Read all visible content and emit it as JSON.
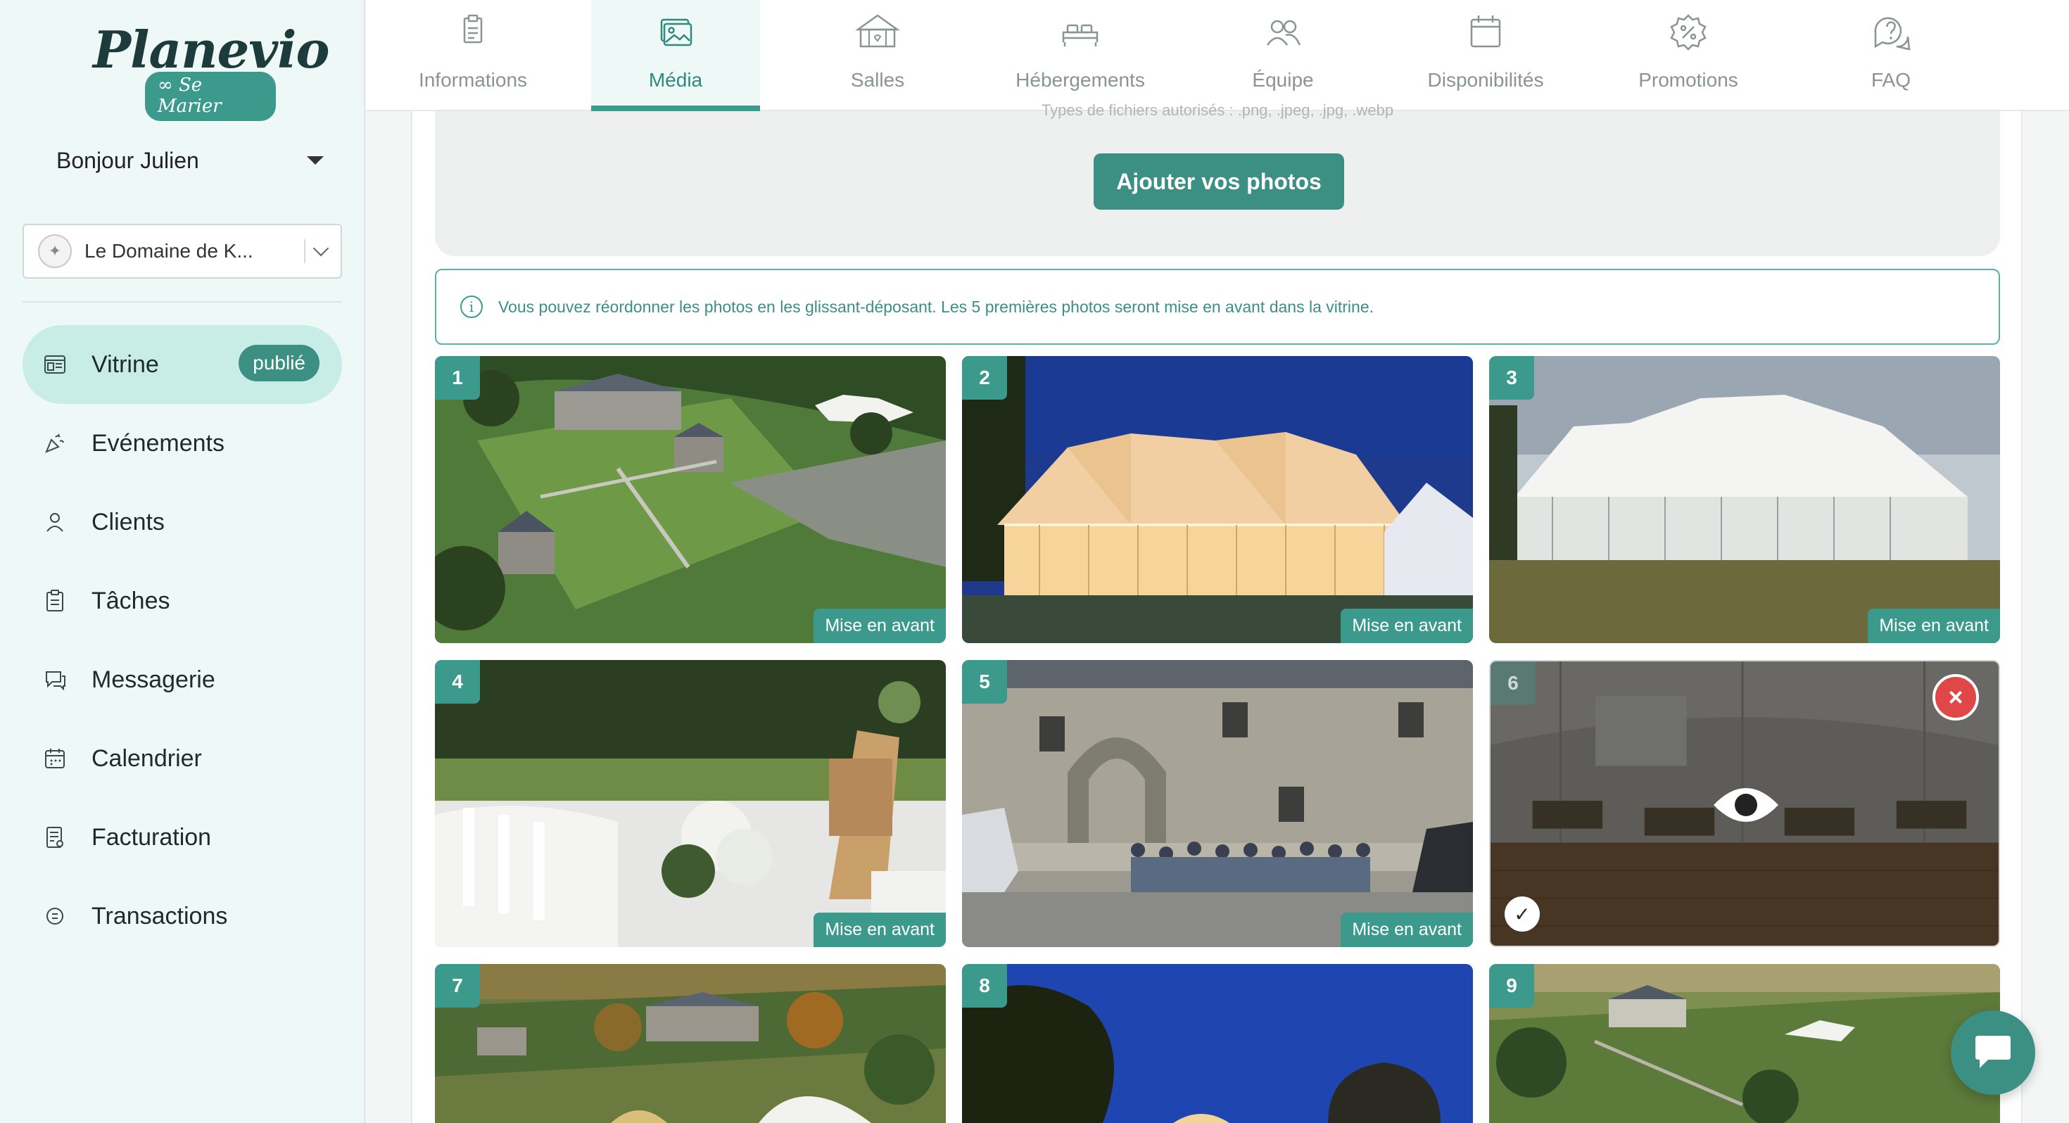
{
  "brand": {
    "name": "Planevio",
    "tagline": "Se Marier"
  },
  "sidebar": {
    "greeting": "Bonjour Julien",
    "venue": "Le Domaine de K...",
    "items": [
      {
        "label": "Vitrine",
        "icon": "storefront-icon",
        "badge": "publié",
        "active": true
      },
      {
        "label": "Evénements",
        "icon": "party-icon"
      },
      {
        "label": "Clients",
        "icon": "user-icon"
      },
      {
        "label": "Tâches",
        "icon": "clipboard-icon"
      },
      {
        "label": "Messagerie",
        "icon": "chat-icon"
      },
      {
        "label": "Calendrier",
        "icon": "calendar-icon"
      },
      {
        "label": "Facturation",
        "icon": "invoice-icon"
      },
      {
        "label": "Transactions",
        "icon": "coin-icon"
      }
    ]
  },
  "tabs": [
    {
      "label": "Informations",
      "icon": "document-icon"
    },
    {
      "label": "Média",
      "icon": "image-icon",
      "active": true
    },
    {
      "label": "Salles",
      "icon": "tent-icon"
    },
    {
      "label": "Hébergements",
      "icon": "bed-icon"
    },
    {
      "label": "Équipe",
      "icon": "team-icon"
    },
    {
      "label": "Disponibilités",
      "icon": "calendar-icon"
    },
    {
      "label": "Promotions",
      "icon": "percent-badge-icon"
    },
    {
      "label": "FAQ",
      "icon": "question-icon"
    }
  ],
  "upload": {
    "hint": "Types de fichiers autorisés : .png, .jpeg, .jpg, .webp",
    "button": "Ajouter vos photos"
  },
  "info": "Vous pouvez réordonner les photos en les glissant-déposant. Les 5 premières photos seront mise en avant dans la vitrine.",
  "photos": [
    {
      "num": "1",
      "featured": "Mise en avant"
    },
    {
      "num": "2",
      "featured": "Mise en avant"
    },
    {
      "num": "3",
      "featured": "Mise en avant"
    },
    {
      "num": "4",
      "featured": "Mise en avant"
    },
    {
      "num": "5",
      "featured": "Mise en avant"
    },
    {
      "num": "6"
    },
    {
      "num": "7"
    },
    {
      "num": "8"
    },
    {
      "num": "9"
    }
  ],
  "colors": {
    "accent": "#3c9a8c",
    "accent_dark": "#3c8f83",
    "danger": "#e04848"
  }
}
